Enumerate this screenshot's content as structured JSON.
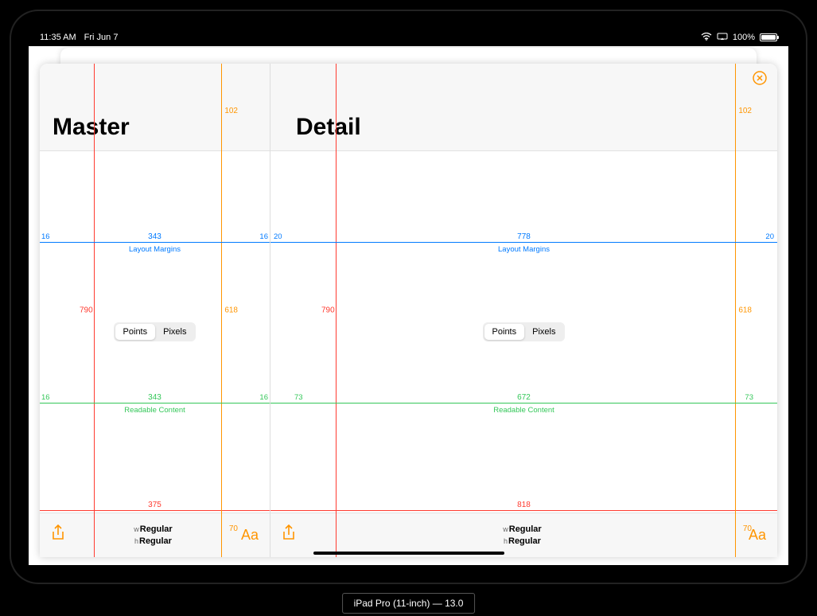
{
  "statusbar": {
    "time": "11:35 AM",
    "date": "Fri Jun 7",
    "battery_pct": "100%"
  },
  "close_label": "ⓧ",
  "master": {
    "title": "Master",
    "seg_points": "Points",
    "seg_pixels": "Pixels",
    "sizeclass_w_label": "w",
    "sizeclass_w": "Regular",
    "sizeclass_h_label": "h",
    "sizeclass_h": "Regular",
    "aa": "Aa",
    "meas": {
      "width_pts": "375",
      "safe_top_pts": "102",
      "safe_height_pts": "618",
      "full_height_pts": "790",
      "safe_bottom_pts": "70",
      "layout_margins_label": "Layout Margins",
      "layout_margin_left": "16",
      "layout_margin_width": "343",
      "layout_margin_right": "16",
      "readable_label": "Readable Content",
      "readable_left": "16",
      "readable_width": "343",
      "readable_right": "16"
    }
  },
  "detail": {
    "title": "Detail",
    "seg_points": "Points",
    "seg_pixels": "Pixels",
    "sizeclass_w_label": "w",
    "sizeclass_w": "Regular",
    "sizeclass_h_label": "h",
    "sizeclass_h": "Regular",
    "aa": "Aa",
    "meas": {
      "width_pts": "818",
      "safe_top_pts": "102",
      "safe_height_pts": "618",
      "full_height_pts": "790",
      "safe_bottom_pts": "70",
      "layout_margins_label": "Layout Margins",
      "layout_margin_left": "20",
      "layout_margin_width": "778",
      "layout_margin_right": "20",
      "readable_label": "Readable Content",
      "readable_left": "73",
      "readable_width": "672",
      "readable_right": "73"
    }
  },
  "device_label": "iPad Pro (11-inch) — 13.0"
}
